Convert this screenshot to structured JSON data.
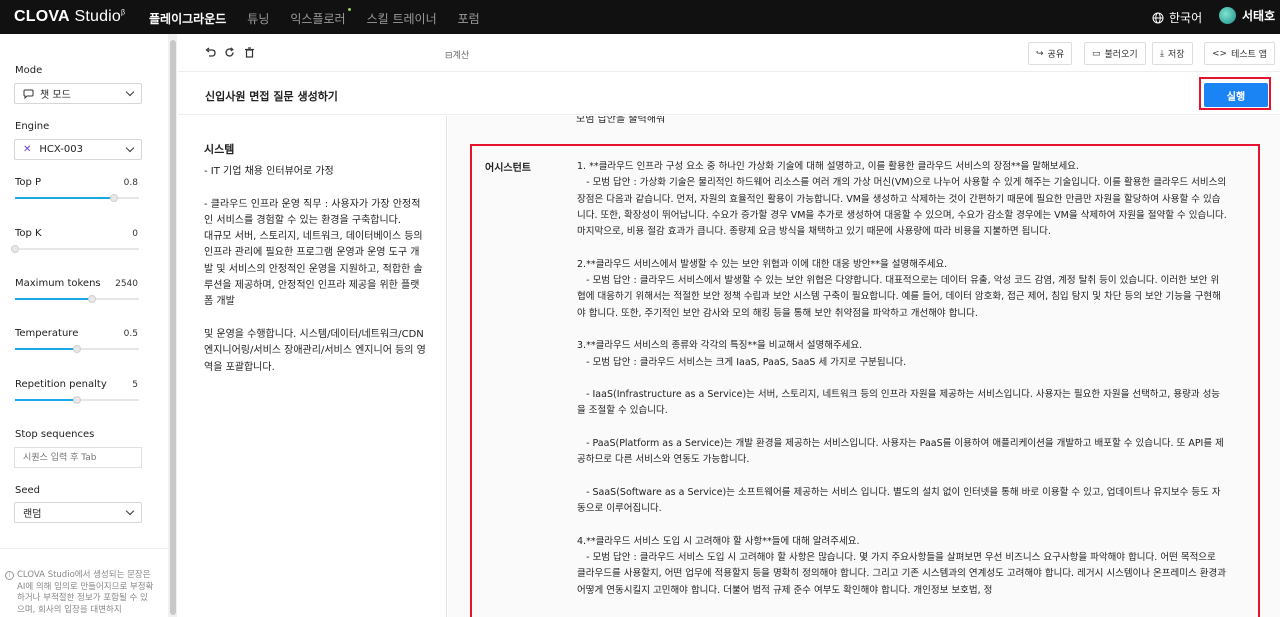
{
  "topbar": {
    "logo_main": "CLOVA",
    "logo_sub": "Studio",
    "logo_sup": "β",
    "nav": [
      "플레이그라운드",
      "튜닝",
      "익스플로러",
      "스킬 트레이너",
      "포럼"
    ],
    "active_nav": "플레이그라운드",
    "language": "한국어",
    "user_name": "서태호"
  },
  "sidebar": {
    "mode_label": "Mode",
    "mode_value": "챗 모드",
    "engine_label": "Engine",
    "engine_value": "HCX-003",
    "params": [
      {
        "label": "Top P",
        "value": "0.8",
        "fraction": 0.8
      },
      {
        "label": "Top K",
        "value": "0",
        "fraction": 0.0
      },
      {
        "label": "Maximum tokens",
        "value": "2540",
        "fraction": 0.62
      },
      {
        "label": "Temperature",
        "value": "0.5",
        "fraction": 0.5
      },
      {
        "label": "Repetition penalty",
        "value": "5",
        "fraction": 0.5
      }
    ],
    "stop_label": "Stop sequences",
    "stop_placeholder": "시퀀스 입력 후 Tab",
    "seed_label": "Seed",
    "seed_value": "랜덤",
    "disclaimer": "CLOVA Studio에서 생성되는 문장은 AI에 의해 임의로 만들어지므로 부정확하거나 부적절한 정보가 포함될 수 있으며, 회사의 입장을 대변하지"
  },
  "toolbar": {
    "calc_label": "계산",
    "share": "공유",
    "load": "불러오기",
    "save": "저장",
    "test_app": "테스트 앱"
  },
  "header": {
    "title": "신입사원 면접 질문 생성하기",
    "run_label": "실행"
  },
  "system": {
    "title": "시스템",
    "text": "- IT 기업 채용 인터뷰어로 가정\n\n- 클라우드 인프라 운영 직무 : 사용자가 가장 안정적인 서비스를 경험할 수 있는 환경을 구축합니다.\n대규모 서버, 스토리지, 네트워크, 데이터베이스 등의 인프라 관리에 필요한 프로그램 운영과 운영 도구 개발 및 서비스의 안정적인 운영을 지원하고, 적합한 솔루션을 제공하며, 안정적인 인프라 제공을 위한 플랫폼 개발\n\n및 운영을 수행합니다. 시스템/데이터/네트워크/CDN 엔지니어링/서비스 장애관리/서비스 엔지니어 등의 영역을 포괄합니다."
  },
  "chat": {
    "prev_text": "모범 답안을 출력해줘",
    "role": "어시스턴트",
    "text": "1. **클라우드 인프라 구성 요소 중 하나인 가상화 기술에 대해 설명하고, 이를 활용한 클라우드 서비스의 장점**을 말해보세요.\n   - 모범 답안 : 가상화 기술은 물리적인 하드웨어 리소스를 여러 개의 가상 머신(VM)으로 나누어 사용할 수 있게 해주는 기술입니다. 이를 활용한 클라우드 서비스의 장점은 다음과 같습니다. 먼저, 자원의 효율적인 활용이 가능합니다. VM을 생성하고 삭제하는 것이 간편하기 때문에 필요한 만큼만 자원을 할당하여 사용할 수 있습니다. 또한, 확장성이 뛰어납니다. 수요가 증가할 경우 VM을 추가로 생성하여 대응할 수 있으며, 수요가 감소할 경우에는 VM을 삭제하여 자원을 절약할 수 있습니다. 마지막으로, 비용 절감 효과가 큽니다. 종량제 요금 방식을 채택하고 있기 때문에 사용량에 따라 비용을 지불하면 됩니다.\n\n2.**클라우드 서비스에서 발생할 수 있는 보안 위협과 이에 대한 대응 방안**을 설명해주세요.\n   - 모범 답안 : 클라우드 서비스에서 발생할 수 있는 보안 위협은 다양합니다. 대표적으로는 데이터 유출, 악성 코드 감염, 계정 탈취 등이 있습니다. 이러한 보안 위협에 대응하기 위해서는 적절한 보안 정책 수립과 보안 시스템 구축이 필요합니다. 예를 들어, 데이터 암호화, 접근 제어, 침입 탐지 및 차단 등의 보안 기능을 구현해야 합니다. 또한, 주기적인 보안 감사와 모의 해킹 등을 통해 보안 취약점을 파악하고 개선해야 합니다.\n\n3.**클라우드 서비스의 종류와 각각의 특징**을 비교해서 설명해주세요.\n   - 모범 답안 : 클라우드 서비스는 크게 IaaS, PaaS, SaaS 세 가지로 구분됩니다.\n\n   - IaaS(Infrastructure as a Service)는 서버, 스토리지, 네트워크 등의 인프라 자원을 제공하는 서비스입니다. 사용자는 필요한 자원을 선택하고, 용량과 성능을 조절할 수 있습니다.\n\n   - PaaS(Platform as a Service)는 개발 환경을 제공하는 서비스입니다. 사용자는 PaaS를 이용하여 애플리케이션을 개발하고 배포할 수 있습니다. 또 API를 제공하므로 다른 서비스와 연동도 가능합니다.\n\n   - SaaS(Software as a Service)는 소프트웨어를 제공하는 서비스 입니다. 별도의 설치 없이 인터넷을 통해 바로 이용할 수 있고, 업데이트나 유지보수 등도 자동으로 이루어집니다.\n\n4.**클라우드 서비스 도입 시 고려해야 할 사항**들에 대해 알려주세요.\n   - 모범 답안 : 클라우드 서비스 도입 시 고려해야 할 사항은 많습니다. 몇 가지 주요사항들을 살펴보면 우선 비즈니스 요구사항을 파악해야 합니다. 어떤 목적으로 클라우드를 사용할지, 어떤 업무에 적용할지 등을 명확히 정의해야 합니다. 그리고 기존 시스템과의 연계성도 고려해야 합니다. 레거시 시스템이나 온프레미스 환경과 어떻게 연동시킬지 고민해야 합니다. 더불어 법적 규제 준수 여부도 확인해야 합니다. 개인정보 보호법, 정"
  }
}
